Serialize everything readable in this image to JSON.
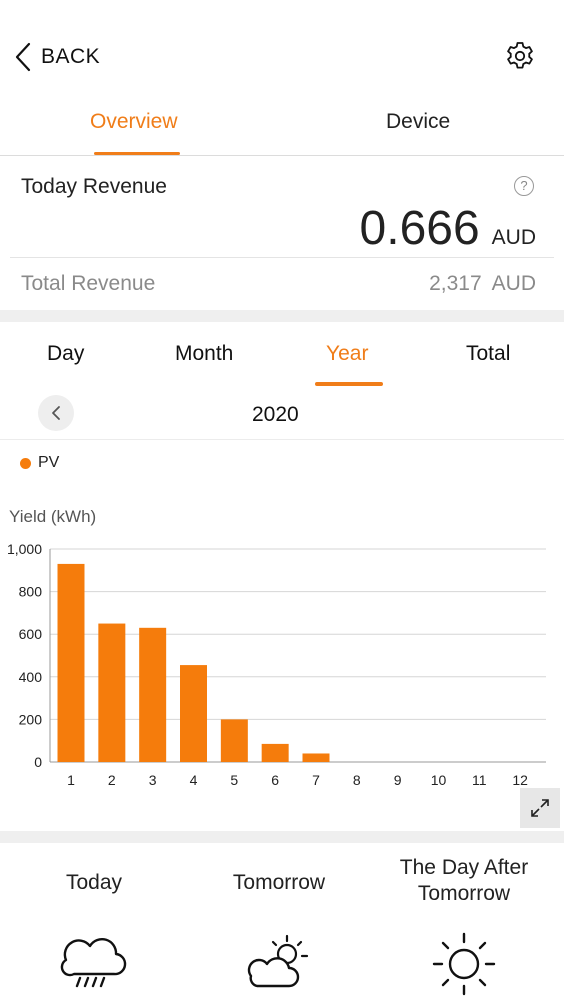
{
  "header": {
    "back_label": "BACK",
    "icons": {
      "back": "chevron-left-icon",
      "settings": "gear-icon"
    }
  },
  "main_tabs": [
    {
      "label": "Overview",
      "active": true
    },
    {
      "label": "Device",
      "active": false
    }
  ],
  "revenue": {
    "today_title": "Today Revenue",
    "help_icon": "?",
    "today_value": "0.666",
    "today_unit": "AUD",
    "total_title": "Total Revenue",
    "total_value": "2,317",
    "total_unit": "AUD"
  },
  "period_tabs": [
    {
      "label": "Day"
    },
    {
      "label": "Month"
    },
    {
      "label": "Year",
      "active": true
    },
    {
      "label": "Total"
    }
  ],
  "year_nav": {
    "year": "2020"
  },
  "colors": {
    "accent": "#f07d19",
    "bar": "#f57c0c"
  },
  "chart_data": {
    "type": "bar",
    "legend": [
      {
        "name": "PV",
        "color": "#f57c0c"
      }
    ],
    "ylabel": "Yield (kWh)",
    "xlabel": "",
    "ylim": [
      0,
      1000
    ],
    "yticks": [
      "0",
      "200",
      "400",
      "600",
      "800",
      "1,000"
    ],
    "categories": [
      "1",
      "2",
      "3",
      "4",
      "5",
      "6",
      "7",
      "8",
      "9",
      "10",
      "11",
      "12"
    ],
    "series": [
      {
        "name": "PV",
        "values": [
          930,
          650,
          630,
          455,
          200,
          85,
          40,
          0,
          0,
          0,
          0,
          0
        ]
      }
    ],
    "grid": true
  },
  "weather": [
    {
      "label": "Today",
      "icon": "rain-cloud-icon"
    },
    {
      "label": "Tomorrow",
      "icon": "partly-cloudy-icon"
    },
    {
      "label": "The Day After Tomorrow",
      "icon": "sun-icon"
    }
  ]
}
